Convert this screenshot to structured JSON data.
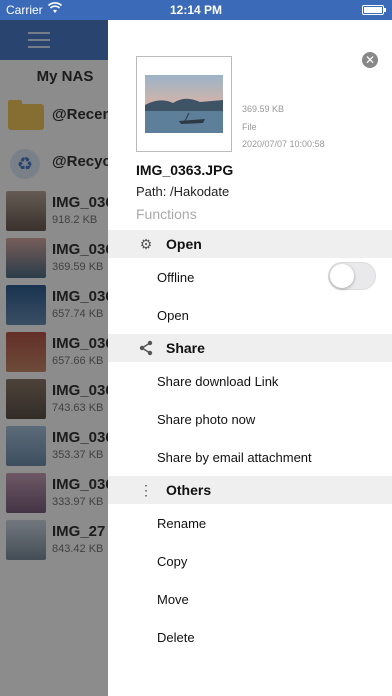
{
  "status_bar": {
    "carrier": "Carrier",
    "time": "12:14 PM"
  },
  "background": {
    "title": "My NAS",
    "folders": [
      {
        "name": "@Recen"
      },
      {
        "name": "@Recyc"
      }
    ],
    "files": [
      {
        "name": "IMG_036",
        "size": "918.2 KB"
      },
      {
        "name": "IMG_036",
        "size": "369.59 KB"
      },
      {
        "name": "IMG_036",
        "size": "657.74 KB"
      },
      {
        "name": "IMG_036",
        "size": "657.66 KB"
      },
      {
        "name": "IMG_036",
        "size": "743.63 KB"
      },
      {
        "name": "IMG_036",
        "size": "353.37 KB"
      },
      {
        "name": "IMG_036",
        "size": "333.97 KB"
      },
      {
        "name": "IMG_27",
        "size": "843.42 KB"
      }
    ]
  },
  "panel": {
    "file": {
      "size": "369.59 KB",
      "type": "File",
      "date": "2020/07/07 10:00:58",
      "name": "IMG_0363.JPG",
      "path": "Path: /Hakodate"
    },
    "functions_label": "Functions",
    "sections": {
      "open": {
        "label": "Open",
        "icon": "gear-icon",
        "offline_label": "Offline",
        "offline_on": false,
        "open_label": "Open"
      },
      "share": {
        "label": "Share",
        "icon": "share-icon",
        "items": [
          "Share download Link",
          "Share photo now",
          "Share by email attachment"
        ]
      },
      "others": {
        "label": "Others",
        "icon": "more-vertical-icon",
        "items": [
          "Rename",
          "Copy",
          "Move",
          "Delete"
        ]
      }
    }
  }
}
